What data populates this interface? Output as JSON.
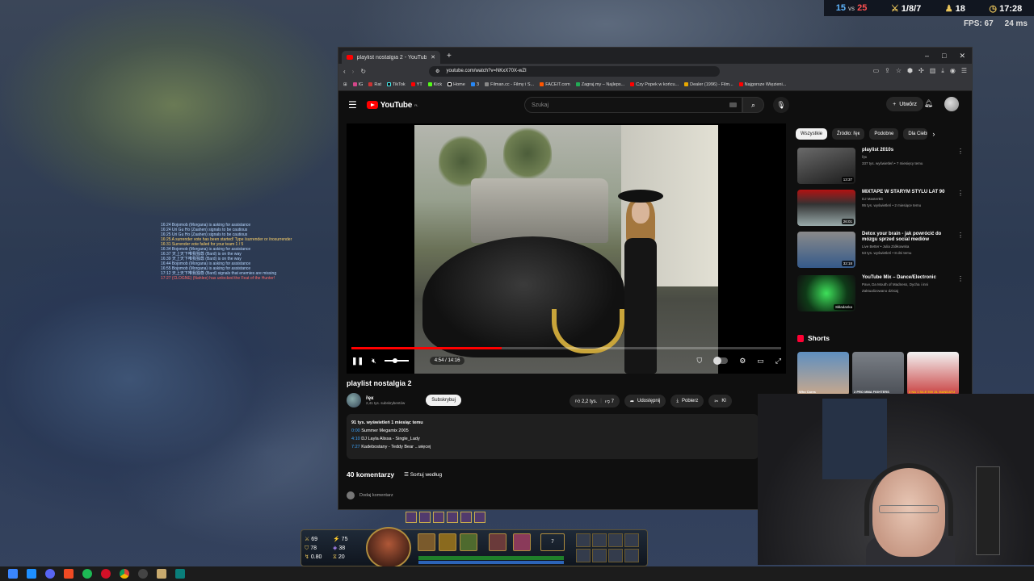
{
  "hud": {
    "blue_kills": "15",
    "vs": "vs",
    "red_kills": "25",
    "kda": "1/8/7",
    "cs": "18",
    "clock": "17:28",
    "fps": "FPS: 67",
    "ping": "24 ms"
  },
  "chat": [
    {
      "text": "16:24 Bojomob (Morgana) is asking for assistance",
      "type": "info"
    },
    {
      "text": "16:24 Uri Gu Ho (Zaahen) signals to be cautious",
      "type": "info"
    },
    {
      "text": "16:25 Uri Gu Ho (Zaahen) signals to be cautious",
      "type": "info"
    },
    {
      "text": "16:25 A surrender vote has been started! Type /surrender or /nosurrender",
      "type": "warn"
    },
    {
      "text": "16:31 Surrender vote failed for your team 1 / 5",
      "type": "warn"
    },
    {
      "text": "16:34 Bojomob (Morgana) is asking for assistance",
      "type": "info"
    },
    {
      "text": "16:37 天上天下唯我独尊 (Bard) is on the way",
      "type": "info"
    },
    {
      "text": "16:39 天上天下唯我独尊 (Bard) is on the way",
      "type": "info"
    },
    {
      "text": "16:44 Bojomob (Morgana) is asking for assistance",
      "type": "info"
    },
    {
      "text": "16:55 Bojomob (Morgana) is asking for assistance",
      "type": "info"
    },
    {
      "text": "17:12 天上天下唯我独尊 (Bard) signals that enemies are missing",
      "type": "info"
    },
    {
      "text": "17:27 (CLOGNE) (Nahlee) has unlocked the Feat of the Hunter!",
      "type": "red"
    }
  ],
  "browser": {
    "tab_title": "playlist nostalgia 2 - YouTube",
    "new_tab": "+",
    "minimize": "–",
    "maximize": "□",
    "close": "✕",
    "url": "youtube.com/watch?v=NKxX70X-wZI",
    "bookmarks": [
      "IG",
      "Rat",
      "TikTok",
      "YT",
      "Kick",
      "Home",
      "З",
      "Filman.cc - Filmy i S...",
      "FACEIT.com",
      "Zagraj.my – Najleps...",
      "Czy Popek w końcu...",
      "Dealer (1996) - Film...",
      "Najgorsze Więzieni..."
    ]
  },
  "youtube": {
    "logo": "YouTube",
    "logo_region": "PL",
    "search_placeholder": "Szukaj",
    "create": "Utwórz",
    "player": {
      "progress": 0.35,
      "time": "4:54 / 14:16"
    },
    "video_title": "playlist nostalgia 2",
    "channel_name": "řęк",
    "channel_subs": "2,41 tys. subskrybentów",
    "subscribe": "Subskrybuj",
    "likes": "2,2 tys.",
    "dislikes": "7",
    "share": "Udostępnij",
    "download": "Pobierz",
    "clip": "Kl",
    "description": {
      "stats": "91 tys. wyświetleń  1 miesiąc temu",
      "lines": [
        {
          "ts": "0:00",
          "text": " Summer Megamix 2005"
        },
        {
          "ts": "4:10",
          "text": " DJ Layla Alissa - Single_Lady"
        },
        {
          "ts": "7:27",
          "text": " Kadebostany - Teddy Bear  ...więcej"
        }
      ]
    },
    "comments_count": "40 komentarzy",
    "sort": "Sortuj według",
    "add_comment": "Dodaj komentarz",
    "chips": [
      "Wszystkie",
      "Źródło: řęк",
      "Podobne",
      "Dla Ciebie"
    ],
    "recommendations": [
      {
        "title": "playlist 2010s",
        "channel": "řęк",
        "meta": "337 tys. wyświetleń • 7 miesięcy temu",
        "duration": "13:37"
      },
      {
        "title": "MIXTAPE W STARYM STYLU LAT 90",
        "channel": "DJ MasterBit",
        "meta": "95 tys. wyświetleń • 2 miesiące temu",
        "duration": "26:01"
      },
      {
        "title": "Detox your brain - jak powrócić do mózgu sprzed social mediów",
        "channel": "Live Better • Julia Ziółkowska",
        "meta": "53 tys. wyświetleń • 8 dni temu",
        "duration": "32:18"
      },
      {
        "title": "YouTube Mix – Dance/Electronic",
        "channel": "Pavv, Da Mouth of Madness, Dycha i inni",
        "meta": "Zaktualizowano dzisiaj",
        "duration": "Składanka"
      }
    ],
    "shorts_heading": "Shorts",
    "shorts": [
      {
        "caption": "Who Cares"
      },
      {
        "caption": "2 PRO MMA FIGHTERS"
      },
      {
        "caption": "3 NA 1 SILE 500 ZŁ MANDATU"
      }
    ]
  },
  "game_hud": {
    "stats": [
      "69",
      "75",
      "78",
      "38",
      "0.80",
      "20"
    ],
    "level": "7"
  }
}
